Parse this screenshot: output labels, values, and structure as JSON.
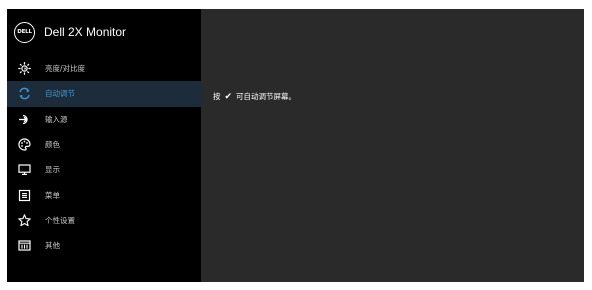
{
  "header": {
    "logo_text": "DELL",
    "title": "Dell 2X Monitor"
  },
  "menu": [
    {
      "label": "亮度/对比度",
      "icon": "brightness-icon",
      "active": false
    },
    {
      "label": "自动调节",
      "icon": "auto-adjust-icon",
      "active": true
    },
    {
      "label": "输入源",
      "icon": "input-source-icon",
      "active": false
    },
    {
      "label": "颜色",
      "icon": "color-palette-icon",
      "active": false
    },
    {
      "label": "显示",
      "icon": "display-icon",
      "active": false
    },
    {
      "label": "菜单",
      "icon": "menu-icon",
      "active": false
    },
    {
      "label": "个性设置",
      "icon": "star-icon",
      "active": false
    },
    {
      "label": "其他",
      "icon": "other-icon",
      "active": false
    }
  ],
  "content": {
    "hint_prefix": "按",
    "hint_icon": "check-icon",
    "hint_suffix": "可自动调节屏幕。"
  },
  "colors": {
    "sidebar_bg": "#000000",
    "content_bg": "#2a2a2a",
    "active_bg": "#1c2c3a",
    "active_text": "#3f95d4"
  }
}
